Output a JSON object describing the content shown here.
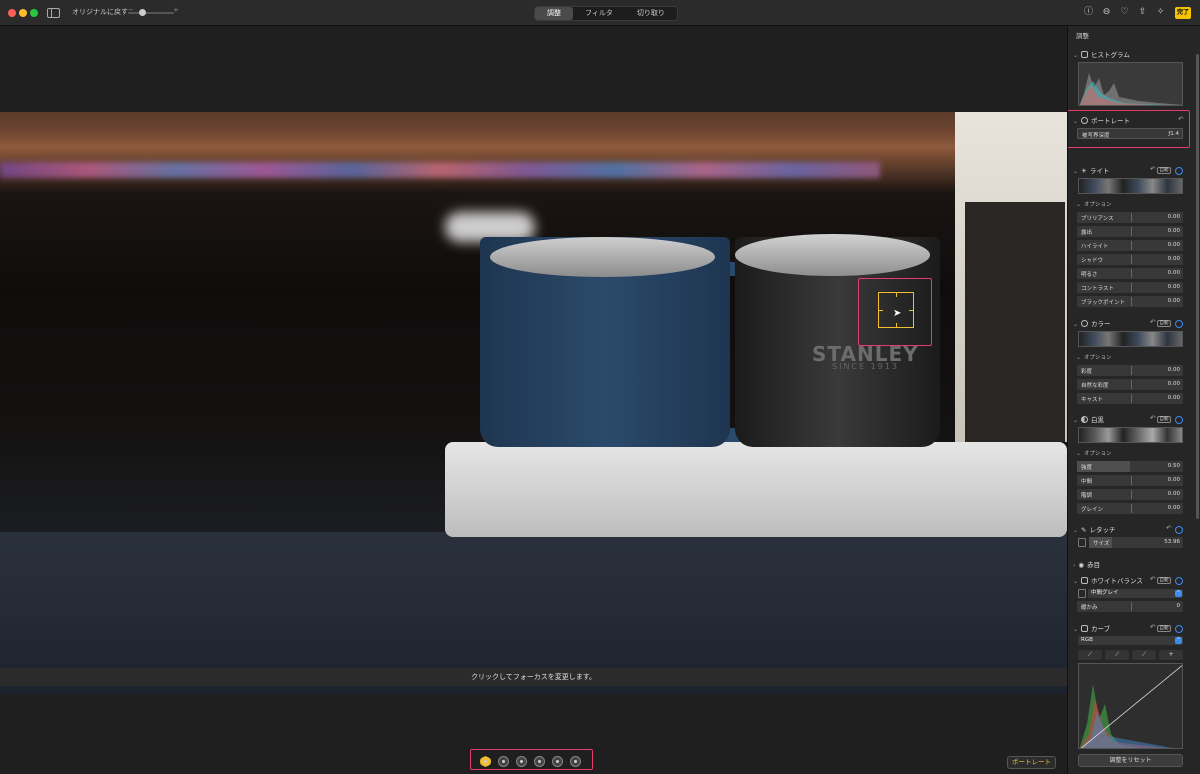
{
  "toolbar": {
    "revert_label": "オリジナルに戻す",
    "zoom_minus": "−",
    "zoom_plus": "+",
    "tabs": [
      {
        "label": "調整"
      },
      {
        "label": "フィルタ"
      },
      {
        "label": "切り取り"
      }
    ],
    "active_tab": "調整",
    "right_icons": [
      "info-icon",
      "more-icon",
      "heart-icon",
      "share-icon",
      "auto-enhance-icon"
    ],
    "done_label": "完了"
  },
  "photo": {
    "brand_text": "STANLEY",
    "brand_sub": "SINCE 1913"
  },
  "canvas": {
    "focus_hint": "クリックしてフォーカスを変更します。",
    "lighting_modes": [
      "natural-light-icon",
      "studio-light-icon",
      "contour-light-icon",
      "stage-light-icon",
      "stage-light-mono-icon",
      "high-key-light-icon"
    ],
    "portrait_button": "ポートレート"
  },
  "panel": {
    "title": "調整",
    "histogram": {
      "label": "ヒストグラム"
    },
    "portrait": {
      "label": "ポートレート",
      "depth_label": "被写界深度",
      "depth_value": "ƒ1.4"
    },
    "light": {
      "label": "ライト",
      "auto": "自動",
      "options_label": "オプション",
      "sliders": [
        {
          "label": "ブリリアンス",
          "value": "0.00"
        },
        {
          "label": "露出",
          "value": "0.00"
        },
        {
          "label": "ハイライト",
          "value": "0.00"
        },
        {
          "label": "シャドウ",
          "value": "0.00"
        },
        {
          "label": "明るさ",
          "value": "0.00"
        },
        {
          "label": "コントラスト",
          "value": "0.00"
        },
        {
          "label": "ブラックポイント",
          "value": "0.00"
        }
      ]
    },
    "color": {
      "label": "カラー",
      "auto": "自動",
      "options_label": "オプション",
      "sliders": [
        {
          "label": "彩度",
          "value": "0.00"
        },
        {
          "label": "自然な彩度",
          "value": "0.00"
        },
        {
          "label": "キャスト",
          "value": "0.00"
        }
      ]
    },
    "bw": {
      "label": "白黒",
      "auto": "自動",
      "options_label": "オプション",
      "sliders": [
        {
          "label": "強度",
          "value": "0.50",
          "fill": 0.5
        },
        {
          "label": "中間",
          "value": "0.00"
        },
        {
          "label": "階調",
          "value": "0.00"
        },
        {
          "label": "グレイン",
          "value": "0.00"
        }
      ]
    },
    "retouch": {
      "label": "レタッチ",
      "size_label": "サイズ",
      "size_value": "53.96"
    },
    "redeye": {
      "label": "赤目"
    },
    "white_balance": {
      "label": "ホワイトバランス",
      "auto": "自動",
      "mode": "中間グレイ",
      "warmth_label": "暖かみ",
      "warmth_value": "0"
    },
    "curves": {
      "label": "カーブ",
      "auto": "自動",
      "channel": "RGB",
      "add_point": "+"
    },
    "reset_button": "調整をリセット"
  },
  "colors": {
    "accent": "#f5c400",
    "highlight": "#e23c6a",
    "toggle": "#3b8cf3"
  }
}
